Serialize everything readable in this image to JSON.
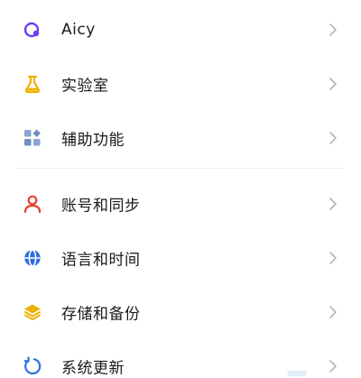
{
  "settings": {
    "group1": [
      {
        "id": "aicy",
        "label": "Aicy",
        "icon": "aicy-icon",
        "color": "#6b3df5"
      },
      {
        "id": "lab",
        "label": "实验室",
        "icon": "flask-icon",
        "color": "#f0b000"
      },
      {
        "id": "accessibility",
        "label": "辅助功能",
        "icon": "grid-icon",
        "color": "#6f8fbf"
      }
    ],
    "group2": [
      {
        "id": "account-sync",
        "label": "账号和同步",
        "icon": "user-icon",
        "color": "#e8402f"
      },
      {
        "id": "language-time",
        "label": "语言和时间",
        "icon": "globe-icon",
        "color": "#2d6fe0"
      },
      {
        "id": "storage-backup",
        "label": "存储和备份",
        "icon": "layers-icon",
        "color": "#f0b000"
      },
      {
        "id": "system-update",
        "label": "系统更新",
        "icon": "update-icon",
        "color": "#2d6fe0"
      }
    ]
  },
  "colors": {
    "chevron": "#b5b5b5",
    "text": "#1a1a1a",
    "divider": "#ececec"
  }
}
